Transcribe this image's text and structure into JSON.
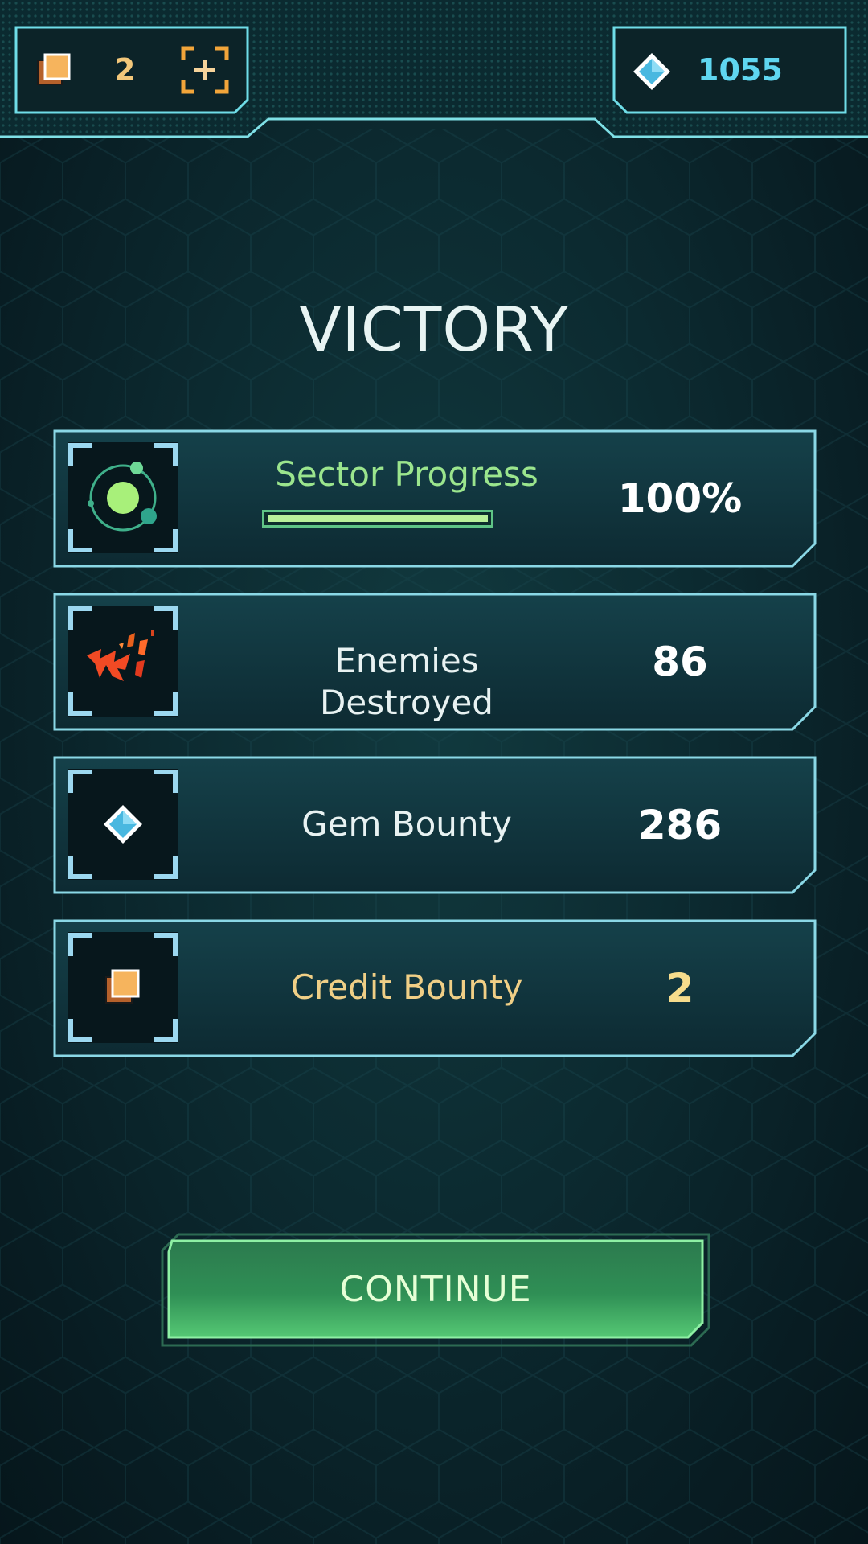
{
  "header": {
    "credits_value": "2",
    "gems_value": "1055"
  },
  "title": "VICTORY",
  "stats": [
    {
      "label": "Sector Progress",
      "value": "100%",
      "progress_fraction": 1.0,
      "icon": "planet-orbit-icon",
      "label_color": "#9be58d"
    },
    {
      "label": "Enemies Destroyed",
      "value": "86",
      "icon": "explosion-debris-icon",
      "label_color": "#e8f2f2"
    },
    {
      "label": "Gem Bounty",
      "value": "286",
      "icon": "gem-icon",
      "label_color": "#e8f2f2"
    },
    {
      "label": "Credit Bounty",
      "value": "2",
      "icon": "credit-stack-icon",
      "label_color": "#f0cf86"
    }
  ],
  "continue_label": "CONTINUE",
  "colors": {
    "frame_stroke": "#7fdce8",
    "accent_green": "#6fd48c",
    "gold": "#f3c77a",
    "cyan": "#5fd6f0",
    "panel_fill": "#12323a"
  }
}
